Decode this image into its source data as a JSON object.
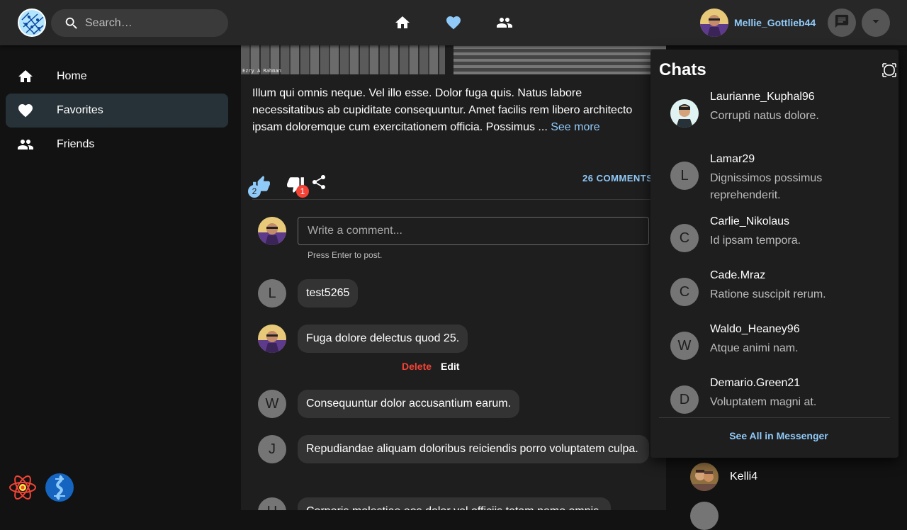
{
  "header": {
    "search_placeholder": "Search…",
    "username": "Mellie_Gottlieb44",
    "icons": [
      "home-icon",
      "heart-icon",
      "people-icon",
      "chat-icon",
      "arrow-drop-down-icon"
    ]
  },
  "sidebar": {
    "items": [
      {
        "label": "Home",
        "icon": "home-icon"
      },
      {
        "label": "Favorites",
        "icon": "heart-icon",
        "active": true
      },
      {
        "label": "Friends",
        "icon": "people-icon"
      }
    ]
  },
  "post": {
    "image_credit": "Ezry A Rahman",
    "text": "Illum qui omnis neque. Vel illo esse. Dolor fuga quis. Natus labore necessitatibus ab cupiditate consequuntur. Amet facilis rem libero architecto ipsam doloremque cum exercitationem officia. Possimus ... ",
    "see_more": "See more",
    "likes": "2",
    "dislikes": "1",
    "comments_label": "26 COMMENTS",
    "comment_placeholder": "Write a comment...",
    "comment_hint": "Press Enter to post.",
    "comments": [
      {
        "avatar_letter": "L",
        "text": "test5265"
      },
      {
        "avatar_letter": "",
        "text": "Fuga dolore delectus quod 25.",
        "own": true
      },
      {
        "avatar_letter": "W",
        "text": "Consequuntur dolor accusantium earum."
      },
      {
        "avatar_letter": "J",
        "text": "Repudiandae aliquam doloribus reiciendis porro voluptatem culpa."
      },
      {
        "avatar_letter": "U",
        "text": "Corporis molestiae eos dolor vel officiis totam nemo omnis."
      }
    ],
    "delete_label": "Delete",
    "edit_label": "Edit"
  },
  "chats": {
    "title": "Chats",
    "items": [
      {
        "name": "Laurianne_Kuphal96",
        "message": "Corrupti natus dolore.",
        "avatar_letter": ""
      },
      {
        "name": "Lamar29",
        "message": "Dignissimos possimus reprehenderit.",
        "avatar_letter": "L"
      },
      {
        "name": "Carlie_Nikolaus",
        "message": "Id ipsam tempora.",
        "avatar_letter": "C"
      },
      {
        "name": "Cade.Mraz",
        "message": "Ratione suscipit rerum.",
        "avatar_letter": "C"
      },
      {
        "name": "Waldo_Heaney96",
        "message": "Atque animi nam.",
        "avatar_letter": "W"
      },
      {
        "name": "Demario.Green21",
        "message": "Voluptatem magni at.",
        "avatar_letter": "D"
      }
    ],
    "see_all": "See All in Messenger"
  },
  "contacts": {
    "items": [
      {
        "name": "Kelli4"
      }
    ]
  },
  "colors": {
    "accent": "#90caf9",
    "danger": "#f44336",
    "topbar": "#272727",
    "background": "#121212",
    "card": "#1e1e1e"
  }
}
